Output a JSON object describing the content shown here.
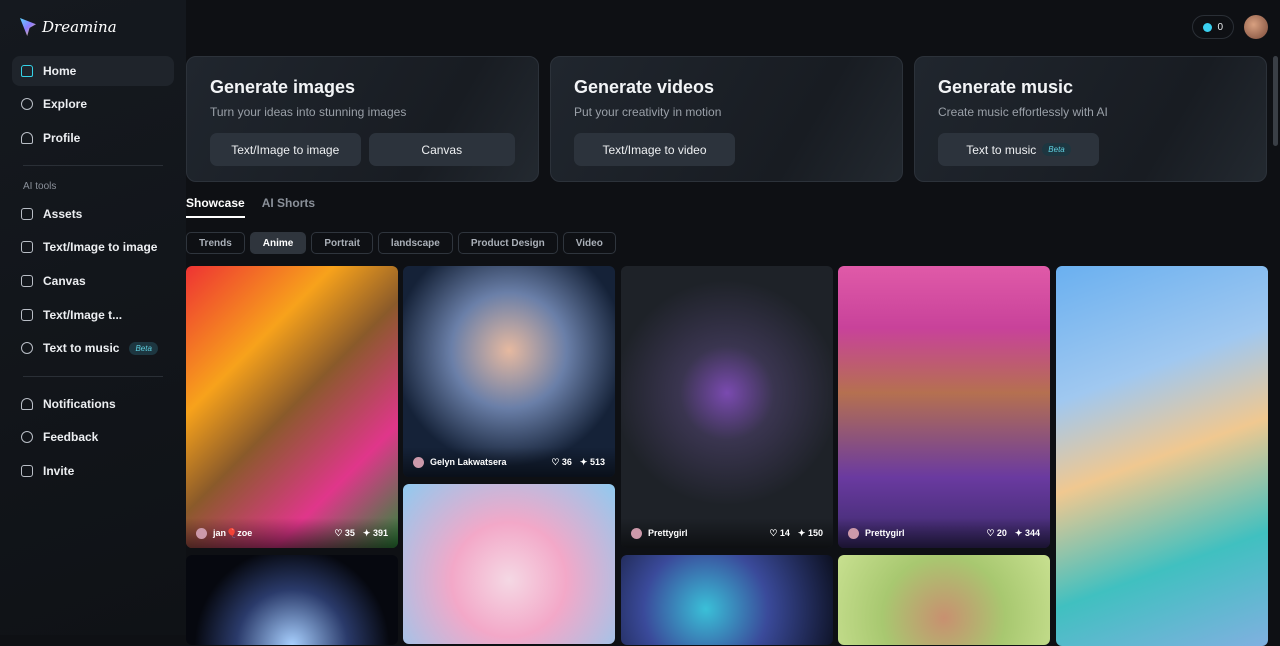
{
  "app": {
    "name": "Dreamina"
  },
  "sidebar": {
    "main": [
      {
        "label": "Home",
        "icon": "home-icon"
      },
      {
        "label": "Explore",
        "icon": "compass-icon"
      },
      {
        "label": "Profile",
        "icon": "user-icon"
      }
    ],
    "section_label": "AI tools",
    "tools": [
      {
        "label": "Assets",
        "icon": "folder-icon"
      },
      {
        "label": "Text/Image to image",
        "icon": "image-plus-icon"
      },
      {
        "label": "Canvas",
        "icon": "canvas-icon"
      },
      {
        "label": "Text/Image t...",
        "icon": "video-icon"
      },
      {
        "label": "Text to music",
        "icon": "music-icon",
        "badge": "Beta"
      }
    ],
    "bottom": [
      {
        "label": "Notifications",
        "icon": "bell-icon"
      },
      {
        "label": "Feedback",
        "icon": "chat-icon"
      },
      {
        "label": "Invite",
        "icon": "gift-icon"
      }
    ]
  },
  "header": {
    "credits": "0"
  },
  "cards": [
    {
      "title": "Generate images",
      "subtitle": "Turn your ideas into stunning images",
      "buttons": [
        "Text/Image to image",
        "Canvas"
      ]
    },
    {
      "title": "Generate videos",
      "subtitle": "Put your creativity in motion",
      "buttons": [
        "Text/Image to video"
      ]
    },
    {
      "title": "Generate music",
      "subtitle": "Create music effortlessly with AI",
      "buttons": [
        "Text to music"
      ],
      "badge": "Beta"
    }
  ],
  "tabs": [
    "Showcase",
    "AI Shorts"
  ],
  "filters": [
    "Trends",
    "Anime",
    "Portrait",
    "landscape",
    "Product Design",
    "Video"
  ],
  "selected_filter": "Anime",
  "feed": [
    {
      "author": "jan🎈zoe",
      "likes": "35",
      "remixes": "391"
    },
    {
      "author": "Gelyn Lakwatsera",
      "likes": "36",
      "remixes": "513"
    },
    {
      "author": "Prettygirl",
      "likes": "14",
      "remixes": "150"
    },
    {
      "author": "Prettygirl",
      "likes": "20",
      "remixes": "344"
    }
  ],
  "colors": {
    "accent": "#35d3e8",
    "background": "#0e1014"
  }
}
